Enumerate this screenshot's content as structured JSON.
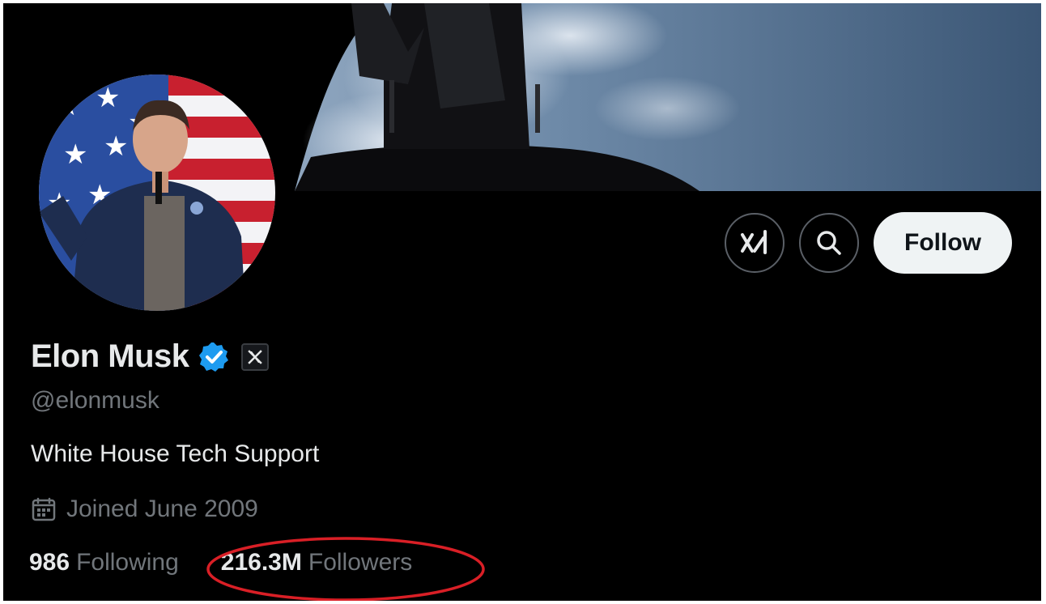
{
  "profile": {
    "name": "Elon Musk",
    "handle": "@elonmusk",
    "bio": "White House Tech Support",
    "joined": "Joined June 2009",
    "verified": true,
    "affiliation_icon": "x-logo-icon"
  },
  "actions": {
    "grok_icon": "xai-icon",
    "search_icon": "search-icon",
    "follow_label": "Follow"
  },
  "stats": {
    "following_count": "986",
    "following_label": "Following",
    "followers_count": "216.3M",
    "followers_label": "Followers"
  },
  "colors": {
    "background": "#000000",
    "primary_text": "#e7e9ea",
    "secondary_text": "#71767b",
    "verified_badge": "#1d9bf0",
    "follow_button_bg": "#eff3f4",
    "annotation_circle": "#d91f26"
  }
}
